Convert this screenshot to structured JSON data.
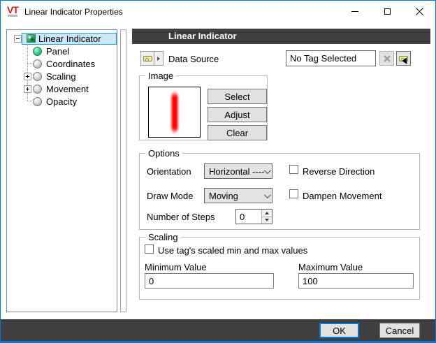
{
  "window": {
    "logo": "VT",
    "title": "Linear Indicator Properties"
  },
  "tree": {
    "items": [
      {
        "label": "Linear Indicator"
      },
      {
        "label": "Panel"
      },
      {
        "label": "Coordinates"
      },
      {
        "label": "Scaling"
      },
      {
        "label": "Movement"
      },
      {
        "label": "Opacity"
      }
    ]
  },
  "panel": {
    "header": "Linear Indicator"
  },
  "data_source": {
    "label": "Data Source",
    "value": "No Tag Selected"
  },
  "image": {
    "title": "Image",
    "select": "Select",
    "adjust": "Adjust",
    "clear": "Clear"
  },
  "options": {
    "title": "Options",
    "orientation_label": "Orientation",
    "orientation_value": "Horizontal ----",
    "reverse_direction_label": "Reverse Direction",
    "draw_mode_label": "Draw Mode",
    "draw_mode_value": "Moving",
    "dampen_movement_label": "Dampen Movement",
    "steps_label": "Number of Steps",
    "steps_value": "0"
  },
  "scaling": {
    "title": "Scaling",
    "use_tag_label": "Use tag's scaled min and max values",
    "min_label": "Minimum Value",
    "min_value": "0",
    "max_label": "Maximum Value",
    "max_value": "100"
  },
  "footer": {
    "ok": "OK",
    "cancel": "Cancel"
  },
  "colors": {
    "accent_blue": "#0078d7",
    "header_dark": "#3f3f41",
    "tree_selected_bg": "#cbe8f6",
    "tree_selected_border": "#26a0da",
    "indicator_red": "#ff0000"
  }
}
